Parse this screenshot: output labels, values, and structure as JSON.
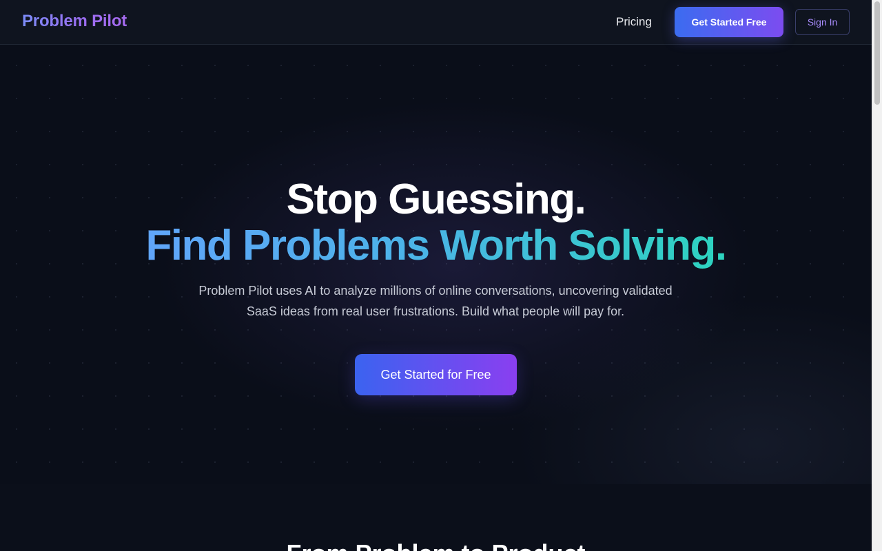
{
  "header": {
    "logo": "Problem Pilot",
    "nav_pricing": "Pricing",
    "get_started_label": "Get Started Free",
    "sign_in_label": "Sign In"
  },
  "hero": {
    "headline_line1": "Stop Guessing.",
    "headline_line2": "Find Problems Worth Solving.",
    "subtitle": "Problem Pilot uses AI to analyze millions of online conversations, uncovering validated SaaS ideas from real user frustrations. Build what people will pay for.",
    "cta_label": "Get Started for Free"
  },
  "section_2": {
    "title": "From Problem to Product"
  },
  "colors": {
    "background": "#0b0f1a",
    "accent_blue": "#3b6cf0",
    "accent_purple": "#8a3ff0",
    "teal": "#2dd4bf"
  }
}
